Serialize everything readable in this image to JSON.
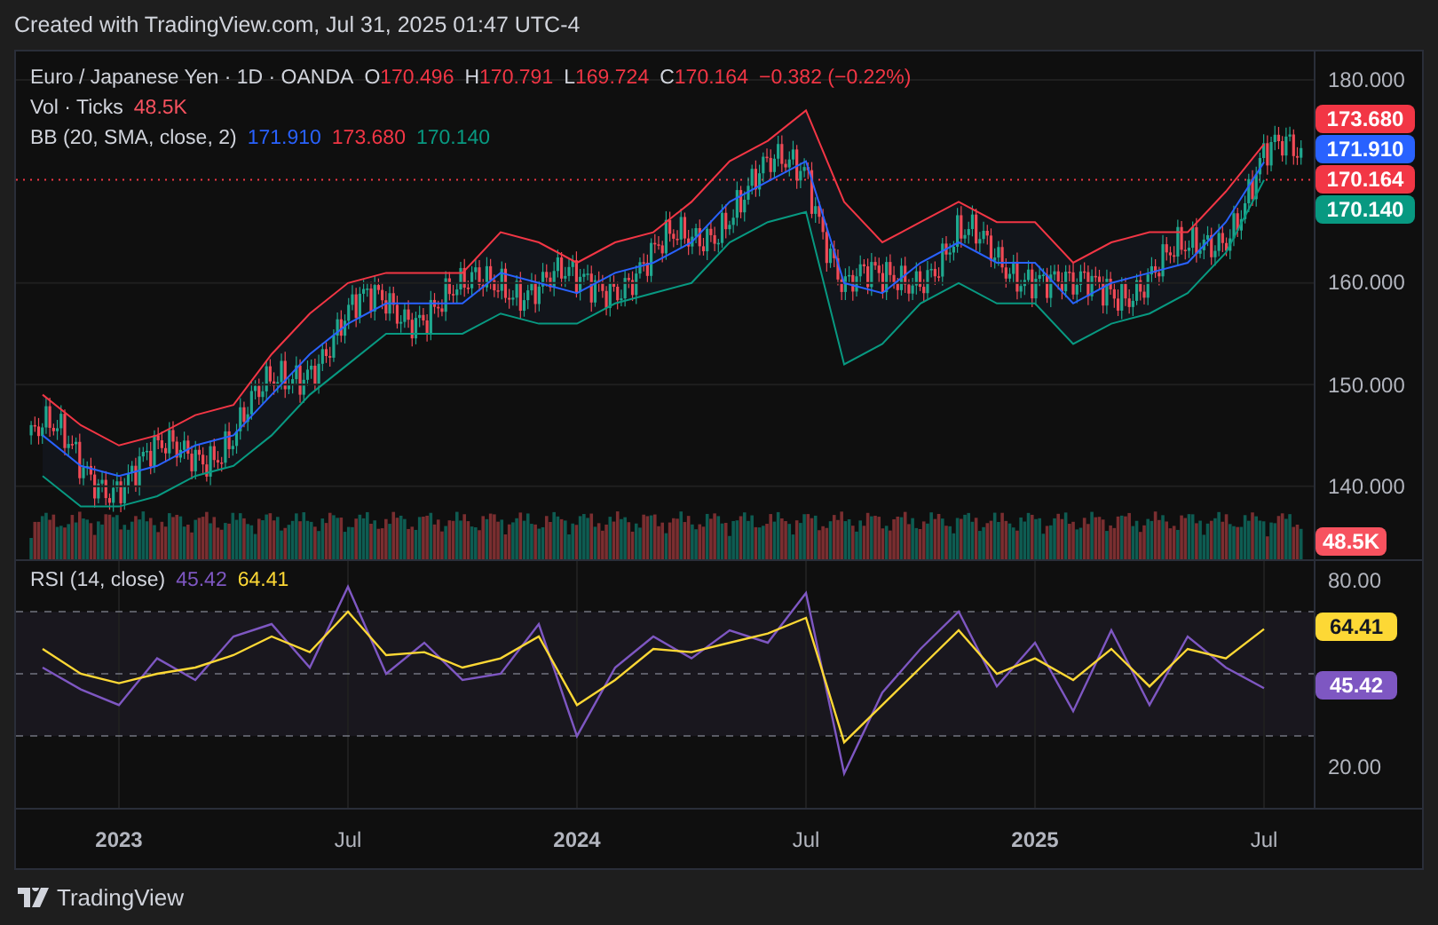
{
  "header": {
    "text": "Created with TradingView.com, Jul 31, 2025 01:47 UTC-4"
  },
  "legend": {
    "symbol": "Euro / Japanese Yen · 1D · OANDA",
    "ohlc": [
      {
        "label": "O",
        "value": "170.496"
      },
      {
        "label": "H",
        "value": "170.791"
      },
      {
        "label": "L",
        "value": "169.724"
      },
      {
        "label": "C",
        "value": "170.164"
      }
    ],
    "change": "−0.382 (−0.22%)",
    "volume": {
      "label": "Vol · Ticks",
      "value": "48.5K"
    },
    "bb": {
      "label": "BB (20, SMA, close, 2)",
      "values": [
        {
          "text": "171.910",
          "color": "#2962ff"
        },
        {
          "text": "173.680",
          "color": "#f23645"
        },
        {
          "text": "170.140",
          "color": "#089981"
        }
      ]
    }
  },
  "price_axis": {
    "labels": [
      {
        "text": "173.680",
        "color": "#f23645"
      },
      {
        "text": "171.910",
        "color": "#2962ff"
      },
      {
        "text": "170.164",
        "color": "#f23645"
      },
      {
        "text": "170.140",
        "color": "#089981"
      }
    ],
    "volume_label": {
      "text": "48.5K",
      "color": "#f7525f"
    }
  },
  "price_chart": {
    "chart_data": {
      "type": "line",
      "grid": true,
      "categories": [
        null,
        null,
        null,
        null,
        null,
        null,
        null,
        null,
        null,
        null,
        null,
        null,
        null,
        null,
        null,
        null,
        null,
        null,
        null,
        null,
        null,
        null,
        null,
        null,
        null,
        null,
        null,
        null,
        null,
        null,
        null,
        null,
        null
      ],
      "ylim": [
        132.8,
        182.8
      ],
      "yticks": [
        {
          "value": 180,
          "label": "180.000"
        },
        {
          "value": 160,
          "label": "160.000"
        },
        {
          "value": 150,
          "label": "150.000"
        },
        {
          "value": 140,
          "label": "140.000"
        }
      ],
      "series": [
        {
          "color": "#f23645",
          "values": [
            149,
            146,
            144,
            145,
            147,
            148,
            153,
            157,
            160,
            161,
            161,
            161,
            165,
            164,
            162,
            164,
            165,
            168,
            172,
            174,
            177,
            168,
            164,
            166,
            168,
            166,
            166,
            162,
            164,
            165,
            165,
            169,
            173.68
          ]
        },
        {
          "color": "#2962ff",
          "values": [
            145,
            142,
            141,
            142,
            144,
            145,
            149,
            153,
            156,
            158,
            158,
            158,
            161,
            160,
            159,
            161,
            162,
            164,
            168,
            170,
            172,
            160,
            159,
            162,
            164,
            162,
            162,
            158,
            160,
            161,
            162,
            166,
            171.91
          ]
        },
        {
          "color": "#089981",
          "values": [
            141,
            138,
            138,
            139,
            141,
            142,
            145,
            149,
            152,
            155,
            155,
            155,
            157,
            156,
            156,
            158,
            159,
            160,
            164,
            166,
            167,
            152,
            154,
            158,
            160,
            158,
            158,
            154,
            156,
            157,
            159,
            163,
            170.14
          ]
        }
      ]
    }
  },
  "rsi": {
    "label": "RSI (14, close)",
    "values": [
      {
        "text": "45.42",
        "color": "#7e57c2"
      },
      {
        "text": "64.41",
        "color": "#fdd835"
      }
    ],
    "axis_labels": [
      {
        "text": "64.41",
        "color": "#fdd835"
      },
      {
        "text": "45.42",
        "color": "#7e57c2"
      }
    ],
    "chart_data": {
      "type": "line",
      "grid": true,
      "categories": [
        null,
        null,
        "2023",
        null,
        null,
        null,
        null,
        null,
        "Jul",
        null,
        null,
        null,
        null,
        null,
        "2024",
        null,
        null,
        null,
        null,
        null,
        "Jul",
        null,
        null,
        null,
        null,
        null,
        "2025",
        null,
        null,
        null,
        null,
        null,
        "Jul"
      ],
      "ylim": [
        6.9,
        86.3
      ],
      "yticks": [
        {
          "value": 80,
          "label": "80.00"
        },
        {
          "value": 20,
          "label": "20.00"
        }
      ],
      "series": [
        {
          "color": "#7e57c2",
          "values": [
            52,
            45,
            40,
            55,
            48,
            62,
            66,
            52,
            78,
            50,
            60,
            48,
            50,
            66,
            30,
            52,
            62,
            55,
            64,
            60,
            76,
            18,
            44,
            58,
            70,
            46,
            60,
            38,
            64,
            40,
            62,
            52,
            45.42
          ]
        },
        {
          "color": "#fdd835",
          "values": [
            58,
            50,
            47,
            50,
            52,
            56,
            62,
            57,
            70,
            56,
            57,
            52,
            55,
            62,
            40,
            48,
            58,
            57,
            60,
            63,
            68,
            28,
            40,
            52,
            64,
            50,
            55,
            48,
            58,
            46,
            58,
            55,
            64.41
          ]
        }
      ]
    }
  },
  "footer": {
    "brand": "TradingView"
  }
}
